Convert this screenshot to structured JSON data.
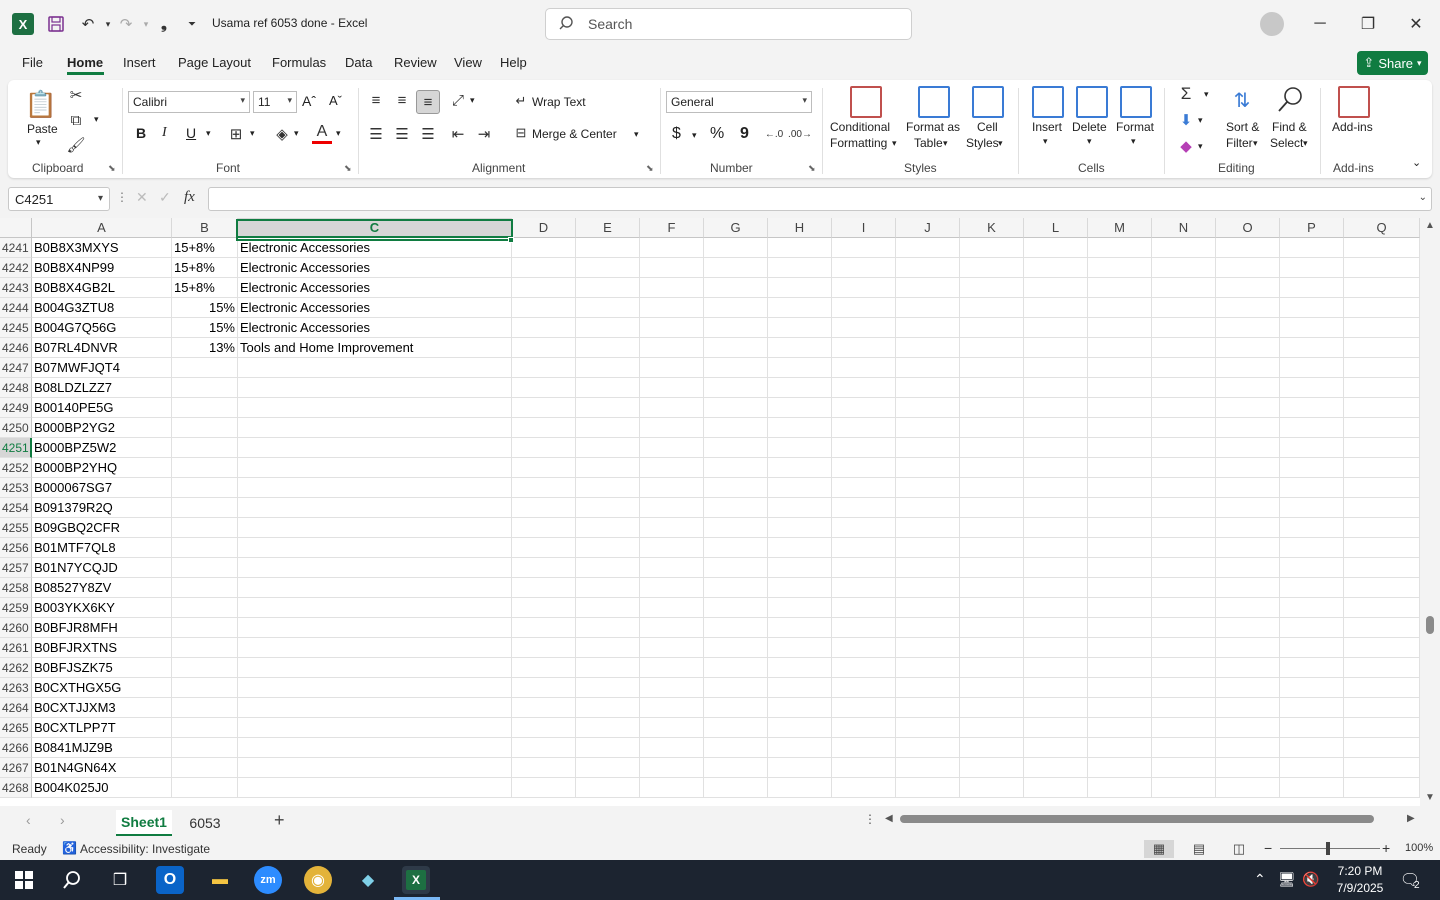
{
  "window": {
    "title": "Usama ref 6053 done  -  Excel",
    "search_placeholder": "Search",
    "app_icon": "X"
  },
  "tabs": [
    "File",
    "Home",
    "Insert",
    "Page Layout",
    "Formulas",
    "Data",
    "Review",
    "View",
    "Help"
  ],
  "share_label": "Share",
  "ribbon": {
    "clipboard": {
      "group": "Clipboard",
      "paste": "Paste"
    },
    "font": {
      "group": "Font",
      "family": "Calibri",
      "size": "11",
      "bold": "B",
      "italic": "I",
      "underline": "U",
      "grow": "Aˆ",
      "shrink": "Aˇ"
    },
    "alignment": {
      "group": "Alignment",
      "wrap": "Wrap Text",
      "merge": "Merge & Center"
    },
    "number": {
      "group": "Number",
      "format": "General",
      "currency": "$",
      "percent": "%",
      "comma": "9"
    },
    "styles": {
      "group": "Styles",
      "conditional_1": "Conditional",
      "conditional_2": "Formatting",
      "format_table_1": "Format as",
      "format_table_2": "Table",
      "cell_styles_1": "Cell",
      "cell_styles_2": "Styles"
    },
    "cells": {
      "group": "Cells",
      "insert": "Insert",
      "delete": "Delete",
      "format": "Format"
    },
    "editing": {
      "group": "Editing",
      "sort_1": "Sort &",
      "sort_2": "Filter",
      "find_1": "Find &",
      "find_2": "Select"
    },
    "addins": {
      "group": "Add-ins",
      "label": "Add-ins"
    }
  },
  "formula_bar": {
    "name_box": "C4251",
    "fx": "fx",
    "value": ""
  },
  "columns": [
    "A",
    "B",
    "C",
    "D",
    "E",
    "F",
    "G",
    "H",
    "I",
    "J",
    "K",
    "L",
    "M",
    "N",
    "O",
    "P",
    "Q"
  ],
  "rows": [
    {
      "num": "4241",
      "a": "B0B8X3MXYS",
      "b": "15+8%",
      "c": "Electronic Accessories"
    },
    {
      "num": "4242",
      "a": "B0B8X4NP99",
      "b": "15+8%",
      "c": "Electronic Accessories"
    },
    {
      "num": "4243",
      "a": "B0B8X4GB2L",
      "b": "15+8%",
      "c": "Electronic Accessories"
    },
    {
      "num": "4244",
      "a": "B004G3ZTU8",
      "b": "15%",
      "c": "Electronic Accessories"
    },
    {
      "num": "4245",
      "a": "B004G7Q56G",
      "b": "15%",
      "c": "Electronic Accessories"
    },
    {
      "num": "4246",
      "a": "B07RL4DNVR",
      "b": "13%",
      "c": "Tools and Home Improvement"
    },
    {
      "num": "4247",
      "a": "B07MWFJQT4",
      "b": "",
      "c": ""
    },
    {
      "num": "4248",
      "a": "B08LDZLZZ7",
      "b": "",
      "c": ""
    },
    {
      "num": "4249",
      "a": "B00140PE5G",
      "b": "",
      "c": ""
    },
    {
      "num": "4250",
      "a": "B000BP2YG2",
      "b": "",
      "c": ""
    },
    {
      "num": "4251",
      "a": "B000BPZ5W2",
      "b": "",
      "c": ""
    },
    {
      "num": "4252",
      "a": "B000BP2YHQ",
      "b": "",
      "c": ""
    },
    {
      "num": "4253",
      "a": "B000067SG7",
      "b": "",
      "c": ""
    },
    {
      "num": "4254",
      "a": "B091379R2Q",
      "b": "",
      "c": ""
    },
    {
      "num": "4255",
      "a": "B09GBQ2CFR",
      "b": "",
      "c": ""
    },
    {
      "num": "4256",
      "a": "B01MTF7QL8",
      "b": "",
      "c": ""
    },
    {
      "num": "4257",
      "a": "B01N7YCQJD",
      "b": "",
      "c": ""
    },
    {
      "num": "4258",
      "a": "B08527Y8ZV",
      "b": "",
      "c": ""
    },
    {
      "num": "4259",
      "a": "B003YKX6KY",
      "b": "",
      "c": ""
    },
    {
      "num": "4260",
      "a": "B0BFJR8MFH",
      "b": "",
      "c": ""
    },
    {
      "num": "4261",
      "a": "B0BFJRXTNS",
      "b": "",
      "c": ""
    },
    {
      "num": "4262",
      "a": "B0BFJSZK75",
      "b": "",
      "c": ""
    },
    {
      "num": "4263",
      "a": "B0CXTHGX5G",
      "b": "",
      "c": ""
    },
    {
      "num": "4264",
      "a": "B0CXTJJXM3",
      "b": "",
      "c": ""
    },
    {
      "num": "4265",
      "a": "B0CXTLPP7T",
      "b": "",
      "c": ""
    },
    {
      "num": "4266",
      "a": "B0841MJZ9B",
      "b": "",
      "c": ""
    },
    {
      "num": "4267",
      "a": "B01N4GN64X",
      "b": "",
      "c": ""
    },
    {
      "num": "4268",
      "a": "B004K025J0",
      "b": "",
      "c": ""
    }
  ],
  "selected_row": "4251",
  "selected_col": "C",
  "sheets": [
    "Sheet1",
    "6053"
  ],
  "status": {
    "ready": "Ready",
    "accessibility": "Accessibility: Investigate",
    "zoom": "100%"
  },
  "taskbar": {
    "time": "7:20 PM",
    "date": "7/9/2025",
    "notifications": "2"
  },
  "colors": {
    "accent": "#107c41",
    "taskbar": "#1c2430"
  }
}
